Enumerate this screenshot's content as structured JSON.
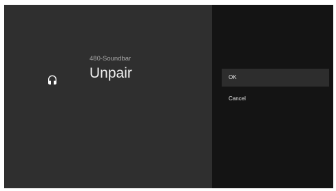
{
  "dialog": {
    "device_icon": "headphones-icon",
    "device_name": "480-Soundbar",
    "title": "Unpair"
  },
  "options": [
    {
      "label": "OK",
      "selected": true
    },
    {
      "label": "Cancel",
      "selected": false
    }
  ],
  "colors": {
    "left_panel_bg": "#2f2f2f",
    "right_panel_bg": "#141414",
    "selected_option_bg": "#2d2d2d",
    "title_text": "#f0f0f0",
    "subtitle_text": "#a9a9a9"
  }
}
